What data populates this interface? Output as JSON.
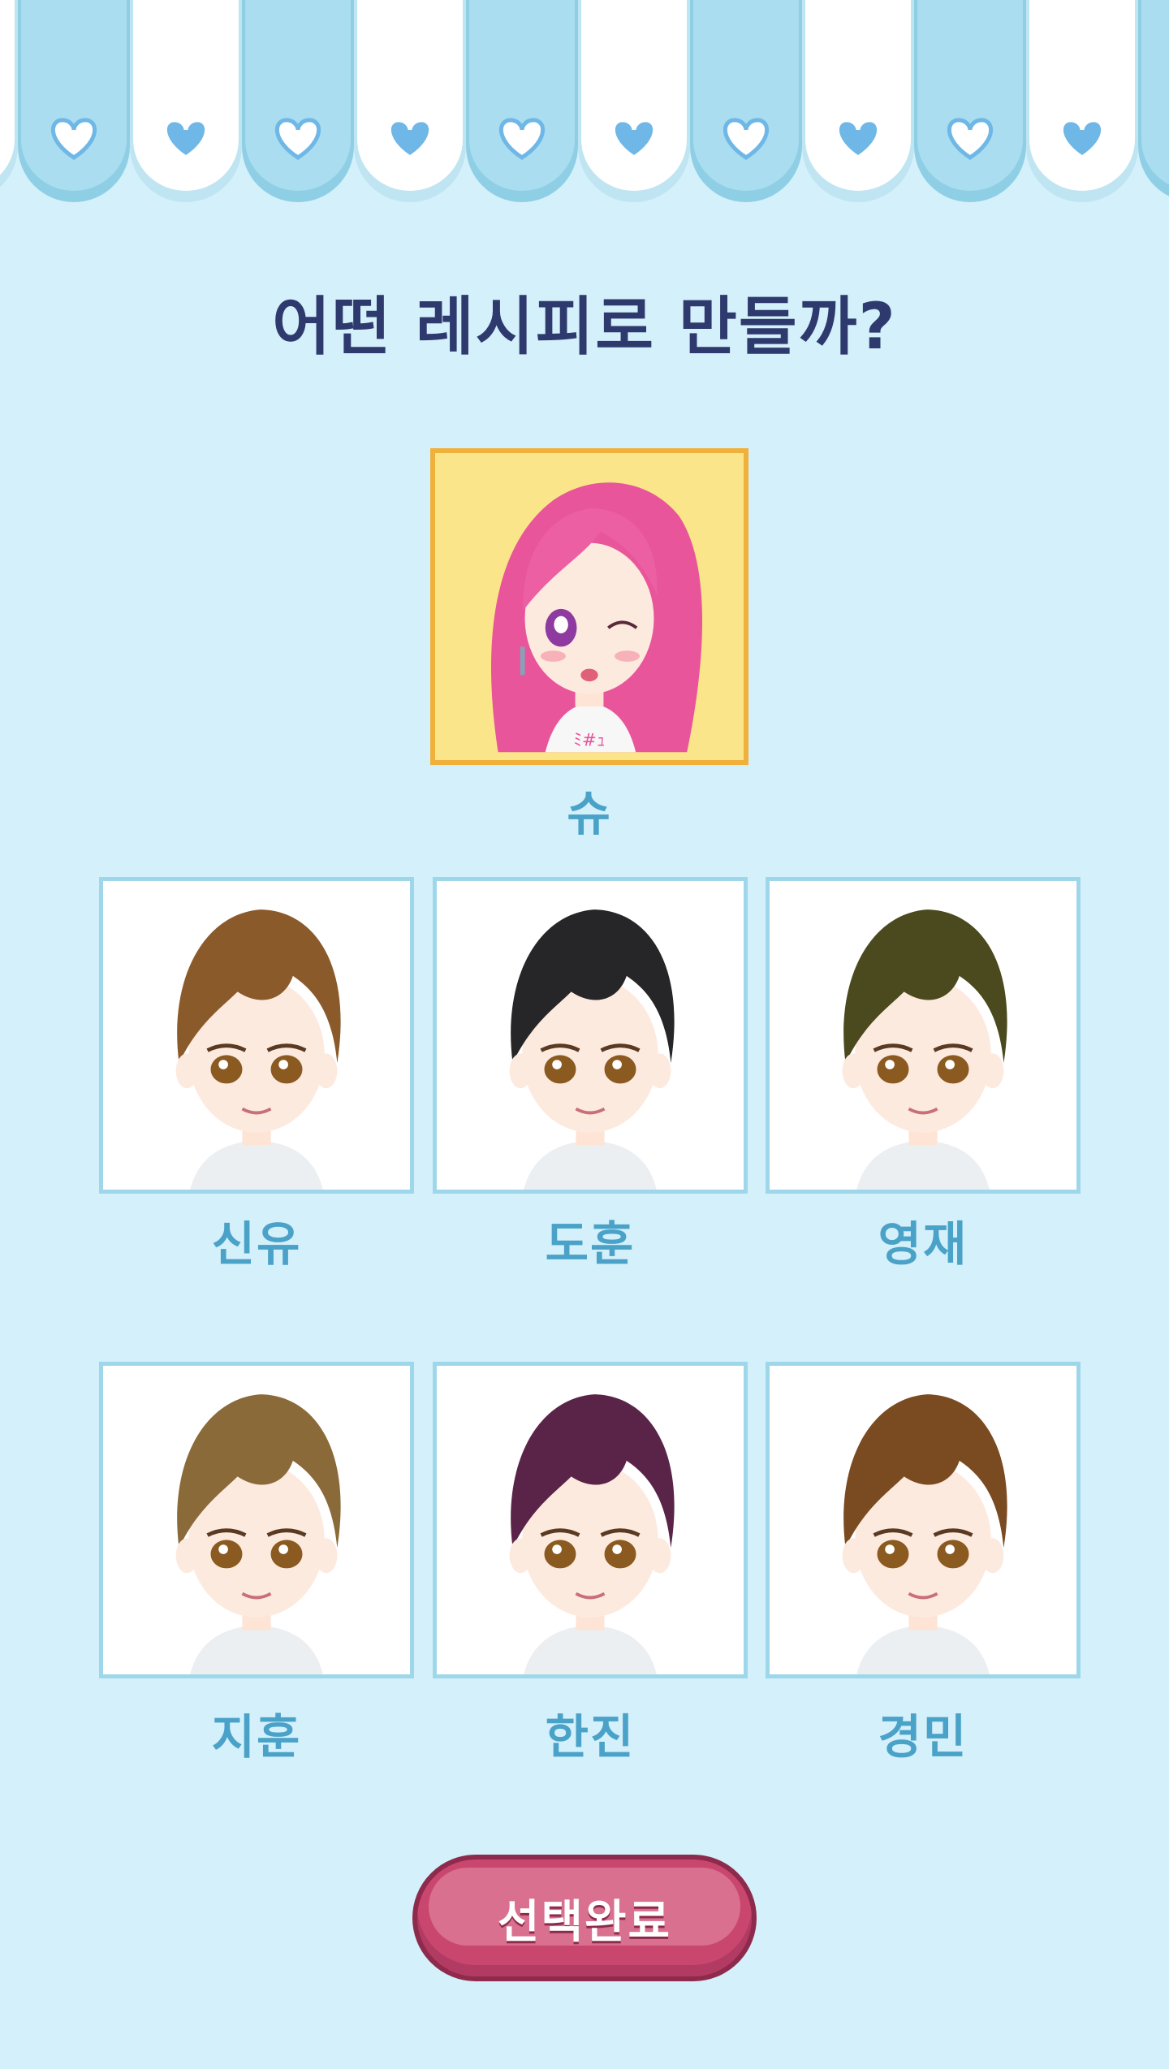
{
  "title": "어떤 레시피로 만들까?",
  "featured": {
    "name": "슈",
    "selected": true
  },
  "characters": [
    {
      "name": "신유",
      "hair": "#8b5a2b"
    },
    {
      "name": "도훈",
      "hair": "#262628"
    },
    {
      "name": "영재",
      "hair": "#4b4a1e"
    },
    {
      "name": "지훈",
      "hair": "#8a6a38"
    },
    {
      "name": "한진",
      "hair": "#5a2448"
    },
    {
      "name": "경민",
      "hair": "#7a4a20"
    }
  ],
  "confirm_button": {
    "label": "선택완료"
  },
  "colors": {
    "background": "#d4f0fa",
    "awning_white": "#ffffff",
    "awning_blue": "#a9ddef",
    "heart_blue": "#6fb7e6",
    "title": "#2e3a6e",
    "name": "#4aa2c8",
    "button": "#c9466f"
  },
  "icons": [
    "heart-icon"
  ]
}
